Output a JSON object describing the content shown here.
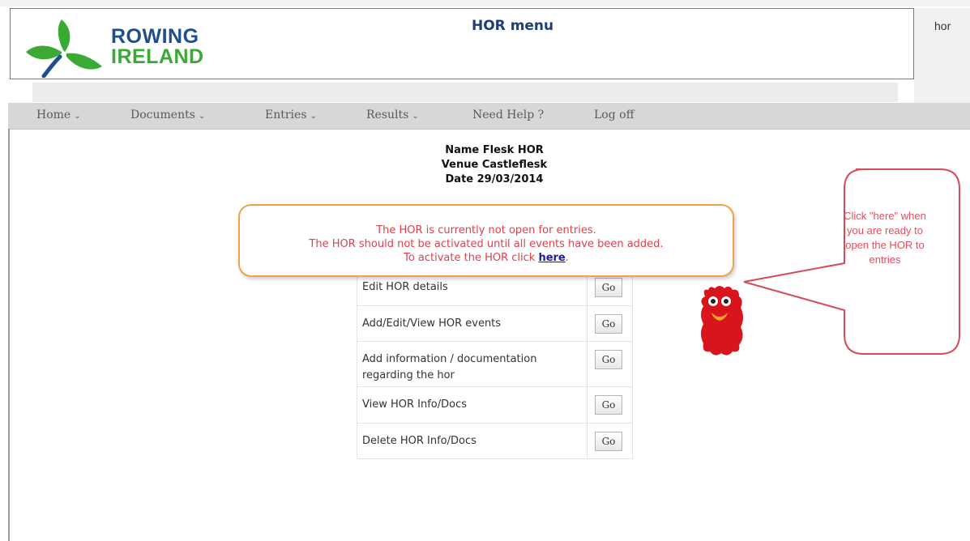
{
  "header": {
    "logo_line1": "ROWING",
    "logo_line2": "IRELAND",
    "title": "HOR menu",
    "user": "hor"
  },
  "nav": [
    {
      "label": "Home",
      "has_dropdown": true
    },
    {
      "label": "Documents",
      "has_dropdown": true
    },
    {
      "label": "Entries",
      "has_dropdown": true
    },
    {
      "label": "Results",
      "has_dropdown": true
    },
    {
      "label": "Need Help ?",
      "has_dropdown": false
    },
    {
      "label": "Log off",
      "has_dropdown": false
    }
  ],
  "info": {
    "name": "Name Flesk HOR",
    "venue": "Venue Castleflesk",
    "date": "Date 29/03/2014"
  },
  "notice": {
    "line1": "The HOR is currently not open for entries.",
    "line2": "The HOR should not be activated until all events have been added.",
    "line3_prefix": "To activate the HOR click",
    "link": "here",
    "line3_suffix": "."
  },
  "menu": [
    {
      "label": "Edit HOR details",
      "button": "Go"
    },
    {
      "label": "Add/Edit/View HOR events",
      "button": "Go"
    },
    {
      "label": "Add information / documentation regarding the hor",
      "button": "Go"
    },
    {
      "label": "View HOR Info/Docs",
      "button": "Go"
    },
    {
      "label": "Delete HOR Info/Docs",
      "button": "Go"
    }
  ],
  "callout": {
    "text": "Click \"here\" when you are ready to open the HOR to entries"
  },
  "colors": {
    "brand_blue": "#1f4e8c",
    "brand_green": "#3aaa35",
    "notice_red": "#e0404a",
    "notice_border": "#f0a24a",
    "callout_red": "#e05060"
  }
}
